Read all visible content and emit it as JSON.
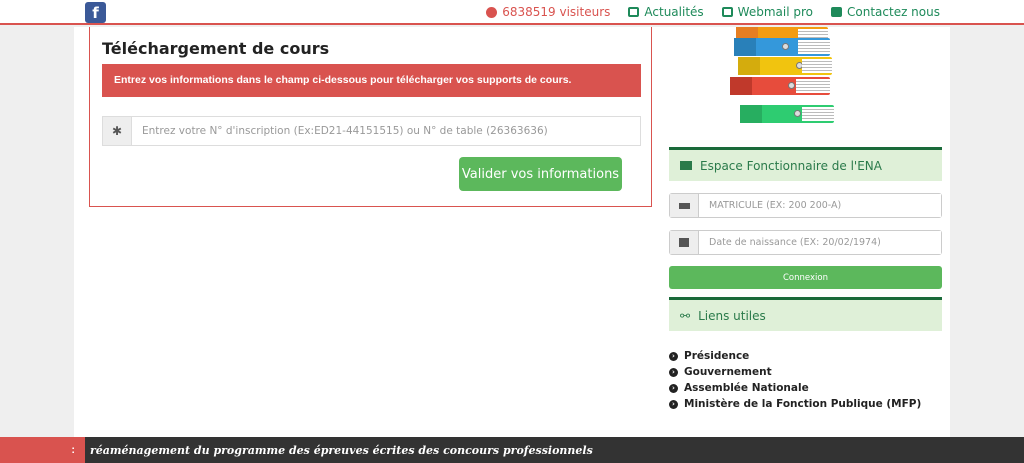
{
  "topbar": {
    "facebook": "f",
    "visitors": "6838519 visiteurs",
    "actualites": "Actualités",
    "webmail": "Webmail pro",
    "contact": "Contactez nous"
  },
  "download": {
    "title": "Téléchargement de cours",
    "alert": "Entrez vos informations dans le champ ci-dessous pour télécharger vos supports de cours.",
    "input_addon": "✱",
    "input_placeholder": "Entrez votre N° d'inscription (Ex:ED21-44151515) ou N° de table (26363636)",
    "submit_label": "Valider vos informations"
  },
  "espace": {
    "title": "Espace Fonctionnaire de l'ENA",
    "matricule_placeholder": "MATRICULE (EX: 200 200-A)",
    "dob_placeholder": "Date de naissance (EX: 20/02/1974)",
    "login_label": "Connexion"
  },
  "liens": {
    "title": "Liens utiles",
    "items": [
      "Présidence",
      "Gouvernement",
      "Assemblée Nationale",
      "Ministère de la Fonction Publique (MFP)"
    ]
  },
  "ticker": {
    "tag": ":",
    "text": "réaménagement du programme des épreuves écrites des concours professionnels"
  },
  "colors": {
    "danger": "#d9534f",
    "success": "#5cb85c",
    "dark_green": "#1a6a3a"
  }
}
